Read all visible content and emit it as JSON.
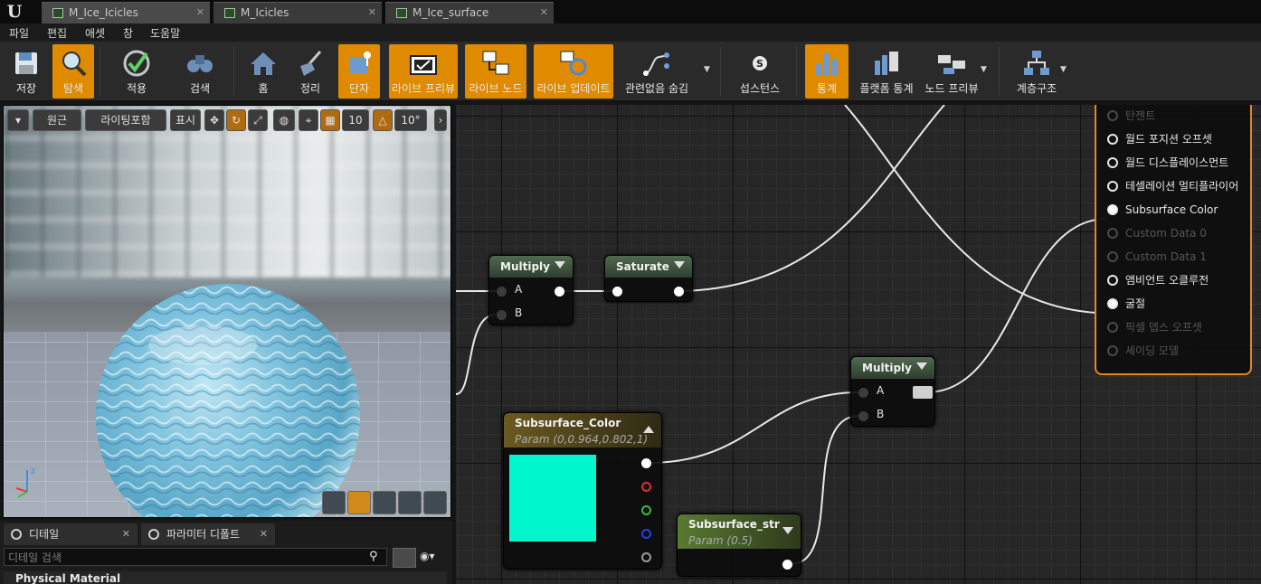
{
  "tabs": [
    {
      "label": "M_Ice_Icicles",
      "active": true
    },
    {
      "label": "M_Icicles",
      "active": false
    },
    {
      "label": "M_Ice_surface",
      "active": false
    }
  ],
  "menu": [
    "파일",
    "편집",
    "애셋",
    "창",
    "도움말"
  ],
  "toolbar": {
    "save": "저장",
    "browse": "탐색",
    "apply": "적용",
    "search": "검색",
    "home": "홈",
    "clean_up": "정리",
    "connectors": "단자",
    "live_preview": "라이브 프리뷰",
    "live_nodes": "라이브 노드",
    "live_update": "라이브 업데이트",
    "hide_unrelated": "관련없음 숨김",
    "substance": "섭스턴스",
    "stats": "통계",
    "platform_stats": "플랫폼 통계",
    "node_preview": "노드 프리뷰",
    "hierarchy": "계층구조"
  },
  "viewport": {
    "perspective": "원근",
    "lit": "라이팅포함",
    "show": "표시",
    "grid_snap": "10",
    "rotation_snap": "10°"
  },
  "details": {
    "tab_details": "디테일",
    "tab_params": "파라미터 디폴트",
    "search_placeholder": "디테일 검색",
    "section": "Physical Material"
  },
  "graph": {
    "multiply1": {
      "title": "Multiply",
      "a": "A",
      "b": "B"
    },
    "saturate": {
      "title": "Saturate"
    },
    "multiply2": {
      "title": "Multiply",
      "a": "A",
      "b": "B"
    },
    "subsurface_color": {
      "title": "Subsurface_Color",
      "sub": "Param (0,0.964,0.802,1)",
      "color": "#00f6cd"
    },
    "subsurface_str": {
      "title": "Subsurface_str",
      "sub": "Param (0.5)"
    },
    "result_pins": [
      {
        "label": "탄젠트",
        "enabled": false
      },
      {
        "label": "월드 포지션 오프셋",
        "enabled": true
      },
      {
        "label": "월드 디스플레이스먼트",
        "enabled": true
      },
      {
        "label": "테셀레이션 멀티플라이어",
        "enabled": true
      },
      {
        "label": "Subsurface Color",
        "enabled": true,
        "connected": true
      },
      {
        "label": "Custom Data 0",
        "enabled": false
      },
      {
        "label": "Custom Data 1",
        "enabled": false
      },
      {
        "label": "앰비언트 오클루전",
        "enabled": true
      },
      {
        "label": "굴절",
        "enabled": true,
        "connected": true
      },
      {
        "label": "픽셀 뎁스 오프셋",
        "enabled": false
      },
      {
        "label": "셰이딩 모델",
        "enabled": false
      }
    ]
  },
  "colors": {
    "accent": "#e08a00",
    "result_border": "#e08a1a"
  }
}
